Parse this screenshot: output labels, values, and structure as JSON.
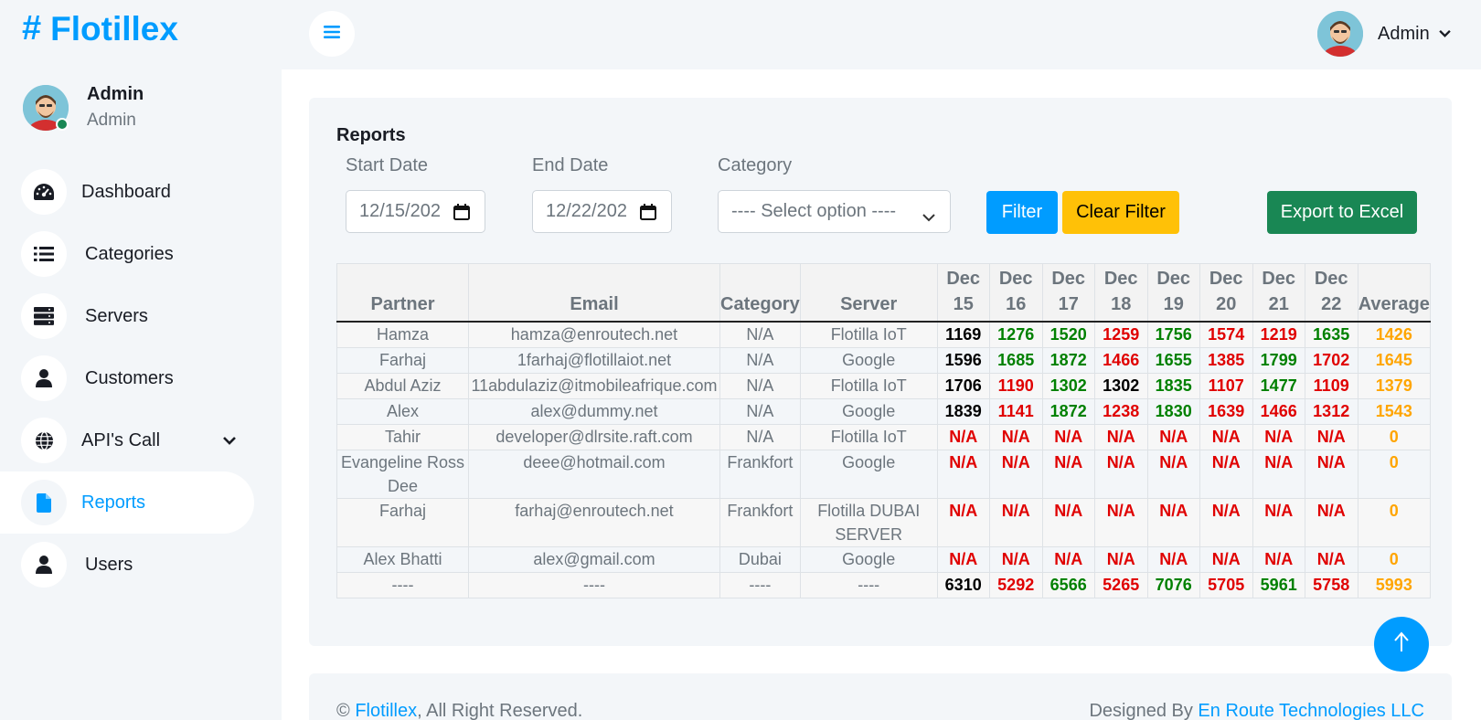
{
  "brand": {
    "symbol": "#",
    "name": "Flotillex"
  },
  "sidebar": {
    "profile": {
      "name": "Admin",
      "role": "Admin"
    },
    "items": [
      {
        "label": "Dashboard",
        "icon": "dashboard-gauge-icon"
      },
      {
        "label": "Categories",
        "icon": "list-icon"
      },
      {
        "label": "Servers",
        "icon": "server-icon"
      },
      {
        "label": "Customers",
        "icon": "user-icon"
      },
      {
        "label": "API's Call",
        "icon": "globe-icon"
      },
      {
        "label": "Reports",
        "icon": "file-icon",
        "active": true
      },
      {
        "label": "Users",
        "icon": "user-icon"
      }
    ]
  },
  "topbar": {
    "user_name": "Admin"
  },
  "reports": {
    "title": "Reports",
    "start_date_label": "Start Date",
    "start_date_value": "12/15/202",
    "end_date_label": "End Date",
    "end_date_value": "12/22/202",
    "category_label": "Category",
    "category_value": "---- Select option ----",
    "filter_label": "Filter",
    "clear_label": "Clear Filter",
    "export_label": "Export to Excel"
  },
  "table": {
    "headers": [
      "Partner",
      "Email",
      "Category",
      "Server",
      "Dec 15",
      "Dec 16",
      "Dec 17",
      "Dec 18",
      "Dec 19",
      "Dec 20",
      "Dec 21",
      "Dec 22",
      "Average"
    ],
    "rows": [
      {
        "partner": "Hamza",
        "email": "hamza@enroutech.net",
        "category": "N/A",
        "server": "Flotilla IoT",
        "values": [
          [
            "1169",
            "black"
          ],
          [
            "1276",
            "green"
          ],
          [
            "1520",
            "green"
          ],
          [
            "1259",
            "red"
          ],
          [
            "1756",
            "green"
          ],
          [
            "1574",
            "red"
          ],
          [
            "1219",
            "red"
          ],
          [
            "1635",
            "green"
          ]
        ],
        "average": "1426"
      },
      {
        "partner": "Farhaj",
        "email": "1farhaj@flotillaiot.net",
        "category": "N/A",
        "server": "Google",
        "values": [
          [
            "1596",
            "black"
          ],
          [
            "1685",
            "green"
          ],
          [
            "1872",
            "green"
          ],
          [
            "1466",
            "red"
          ],
          [
            "1655",
            "green"
          ],
          [
            "1385",
            "red"
          ],
          [
            "1799",
            "green"
          ],
          [
            "1702",
            "red"
          ]
        ],
        "average": "1645"
      },
      {
        "partner": "Abdul Aziz",
        "email": "11abdulaziz@itmobileafrique.com",
        "category": "N/A",
        "server": "Flotilla IoT",
        "values": [
          [
            "1706",
            "black"
          ],
          [
            "1190",
            "red"
          ],
          [
            "1302",
            "green"
          ],
          [
            "1302",
            "black"
          ],
          [
            "1835",
            "green"
          ],
          [
            "1107",
            "red"
          ],
          [
            "1477",
            "green"
          ],
          [
            "1109",
            "red"
          ]
        ],
        "average": "1379"
      },
      {
        "partner": "Alex",
        "email": "alex@dummy.net",
        "category": "N/A",
        "server": "Google",
        "values": [
          [
            "1839",
            "black"
          ],
          [
            "1141",
            "red"
          ],
          [
            "1872",
            "green"
          ],
          [
            "1238",
            "red"
          ],
          [
            "1830",
            "green"
          ],
          [
            "1639",
            "red"
          ],
          [
            "1466",
            "red"
          ],
          [
            "1312",
            "red"
          ]
        ],
        "average": "1543"
      },
      {
        "partner": "Tahir",
        "email": "developer@dlrsite.raft.com",
        "category": "N/A",
        "server": "Flotilla IoT",
        "values": [
          [
            "N/A",
            "red"
          ],
          [
            "N/A",
            "red"
          ],
          [
            "N/A",
            "red"
          ],
          [
            "N/A",
            "red"
          ],
          [
            "N/A",
            "red"
          ],
          [
            "N/A",
            "red"
          ],
          [
            "N/A",
            "red"
          ],
          [
            "N/A",
            "red"
          ]
        ],
        "average": "0"
      },
      {
        "partner": "Evangeline Ross Dee",
        "email": "deee@hotmail.com",
        "category": "Frankfort",
        "server": "Google",
        "values": [
          [
            "N/A",
            "red"
          ],
          [
            "N/A",
            "red"
          ],
          [
            "N/A",
            "red"
          ],
          [
            "N/A",
            "red"
          ],
          [
            "N/A",
            "red"
          ],
          [
            "N/A",
            "red"
          ],
          [
            "N/A",
            "red"
          ],
          [
            "N/A",
            "red"
          ]
        ],
        "average": "0"
      },
      {
        "partner": "Farhaj",
        "email": "farhaj@enroutech.net",
        "category": "Frankfort",
        "server": "Flotilla DUBAI SERVER",
        "values": [
          [
            "N/A",
            "red"
          ],
          [
            "N/A",
            "red"
          ],
          [
            "N/A",
            "red"
          ],
          [
            "N/A",
            "red"
          ],
          [
            "N/A",
            "red"
          ],
          [
            "N/A",
            "red"
          ],
          [
            "N/A",
            "red"
          ],
          [
            "N/A",
            "red"
          ]
        ],
        "average": "0"
      },
      {
        "partner": "Alex Bhatti",
        "email": "alex@gmail.com",
        "category": "Dubai",
        "server": "Google",
        "values": [
          [
            "N/A",
            "red"
          ],
          [
            "N/A",
            "red"
          ],
          [
            "N/A",
            "red"
          ],
          [
            "N/A",
            "red"
          ],
          [
            "N/A",
            "red"
          ],
          [
            "N/A",
            "red"
          ],
          [
            "N/A",
            "red"
          ],
          [
            "N/A",
            "red"
          ]
        ],
        "average": "0"
      },
      {
        "partner": "----",
        "email": "----",
        "category": "----",
        "server": "----",
        "values": [
          [
            "6310",
            "black"
          ],
          [
            "5292",
            "red"
          ],
          [
            "6566",
            "green"
          ],
          [
            "5265",
            "red"
          ],
          [
            "7076",
            "green"
          ],
          [
            "5705",
            "red"
          ],
          [
            "5961",
            "green"
          ],
          [
            "5758",
            "red"
          ]
        ],
        "average": "5993"
      }
    ]
  },
  "footer": {
    "copyright": "©",
    "brand_link": "Flotillex",
    "rights": ", All Right Reserved.",
    "designed_by": "Designed By",
    "designer_link": "En Route Technologies LLC"
  }
}
